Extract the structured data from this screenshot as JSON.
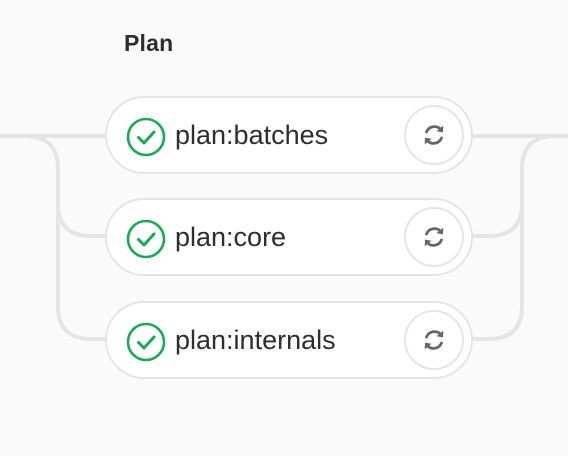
{
  "stage": {
    "title": "Plan"
  },
  "jobs": [
    {
      "name": "plan:batches",
      "status": "success",
      "status_icon": "check-circle-icon",
      "action_icon": "retry-icon"
    },
    {
      "name": "plan:core",
      "status": "success",
      "status_icon": "check-circle-icon",
      "action_icon": "retry-icon"
    },
    {
      "name": "plan:internals",
      "status": "success",
      "status_icon": "check-circle-icon",
      "action_icon": "retry-icon"
    }
  ],
  "colors": {
    "success": "#1aaa55",
    "connector": "#e5e5e5",
    "retry_icon": "#666666",
    "text": "#2e2e2e"
  }
}
